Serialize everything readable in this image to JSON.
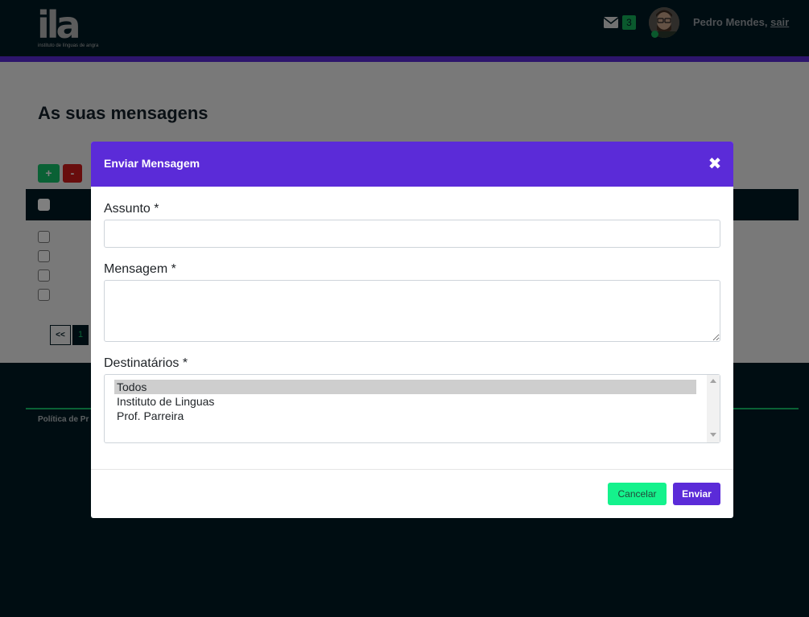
{
  "header": {
    "logo_mark": "ila",
    "logo_tagline": "instituto de línguas de angra",
    "mail_count": "3",
    "user_name": "Pedro Mendes,",
    "logout_label": "sair"
  },
  "page": {
    "title": "As suas mensagens",
    "add_label": "+",
    "remove_label": "-",
    "pager_first": "<<",
    "pager_current": "1"
  },
  "footer": {
    "privacy_link": "Política de Pr"
  },
  "modal": {
    "title": "Enviar Mensagem",
    "close_glyph": "✖",
    "subject_label": "Assunto *",
    "subject_value": "",
    "message_label": "Mensagem *",
    "message_value": "",
    "recipients_label": "Destinatários *",
    "recipients": [
      {
        "label": "Todos",
        "selected": true
      },
      {
        "label": "Instituto de Linguas",
        "selected": false
      },
      {
        "label": "Prof. Parreira",
        "selected": false
      }
    ],
    "cancel_label": "Cancelar",
    "send_label": "Enviar"
  },
  "colors": {
    "brand_purple": "#5b2bd8",
    "brand_green": "#14c26a",
    "dark_navy": "#011a24",
    "cancel_green": "#14f28c",
    "danger_red": "#d01b1b"
  },
  "icons": [
    "envelope-icon",
    "close-icon",
    "scroll-up-icon",
    "scroll-down-icon"
  ]
}
